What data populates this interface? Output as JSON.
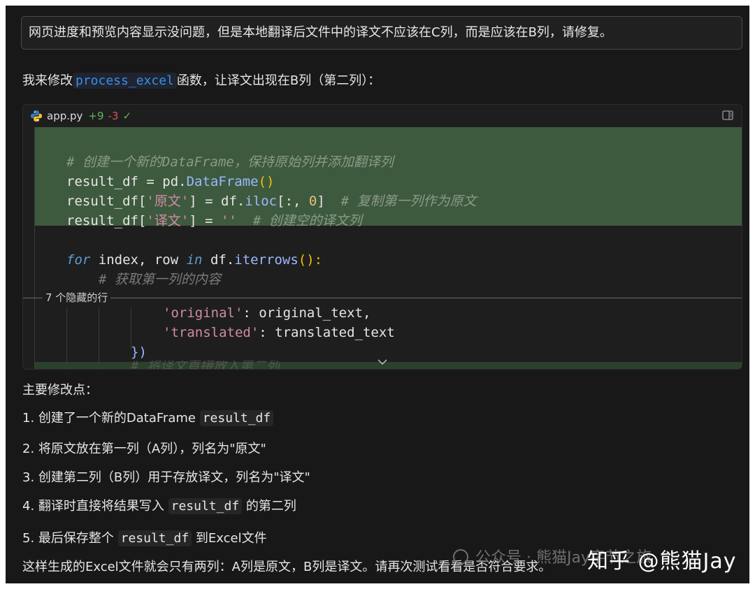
{
  "prompt": {
    "text": "网页进度和预览内容显示没问题，但是本地翻译后文件中的译文不应该在C列，而是应该在B列，请修复。"
  },
  "intro": {
    "prefix": "我来修改",
    "code": "process_excel",
    "suffix": "函数，让译文出现在B列（第二列）："
  },
  "code_card": {
    "file_name": "app.py",
    "additions": "+9",
    "deletions": "-3",
    "status_icon": "check-icon",
    "hidden_lines_label": "7 个隐藏的行",
    "lines": {
      "c1": "# 创建一个新的DataFrame，保持原始列并添加翻译列",
      "l2a": "result_df = pd.",
      "l2b": "DataFrame",
      "l2c": "()",
      "l3a": "result_df[",
      "l3b": "'原文'",
      "l3c": "] = df.",
      "l3d": "iloc",
      "l3e": "[:, ",
      "l3f": "0",
      "l3g": "]  ",
      "l3h": "# 复制第一列作为原文",
      "l4a": "result_df[",
      "l4b": "'译文'",
      "l4c": "] = ",
      "l4d": "''",
      "l4e": "  ",
      "l4f": "# 创建空的译文列",
      "l5a": "for",
      "l5b": " index, row ",
      "l5c": "in",
      "l5d": " df.",
      "l5e": "iterrows",
      "l5f": "():",
      "l6": "# 获取第一列的内容",
      "l7a": "'original'",
      "l7b": ": original_text,",
      "l8a": "'translated'",
      "l8b": ": translated_text",
      "l9a": "})",
      "l10": "# 将译文直接放入第二列"
    }
  },
  "summary": {
    "title": "主要修改点：",
    "items": [
      {
        "text": "1. 创建了一个新的DataFrame ",
        "code": "result_df",
        "after": ""
      },
      {
        "text": "2. 将原文放在第一列（A列），列名为\"原文\"",
        "code": "",
        "after": ""
      },
      {
        "text": "3. 创建第二列（B列）用于存放译文，列名为\"译文\"",
        "code": "",
        "after": ""
      },
      {
        "text": "4. 翻译时直接将结果写入 ",
        "code": "result_df",
        "after": " 的第二列"
      },
      {
        "text": "5. 最后保存整个 ",
        "code": "result_df",
        "after": " 到Excel文件"
      }
    ],
    "closing": "这样生成的Excel文件就会只有两列：A列是原文，B列是译文。请再次测试看看是否符合要求。"
  },
  "watermarks": {
    "wechat": "公众号 · 熊猫Jay字节之旅",
    "zhihu": "知乎 @熊猫Jay"
  }
}
